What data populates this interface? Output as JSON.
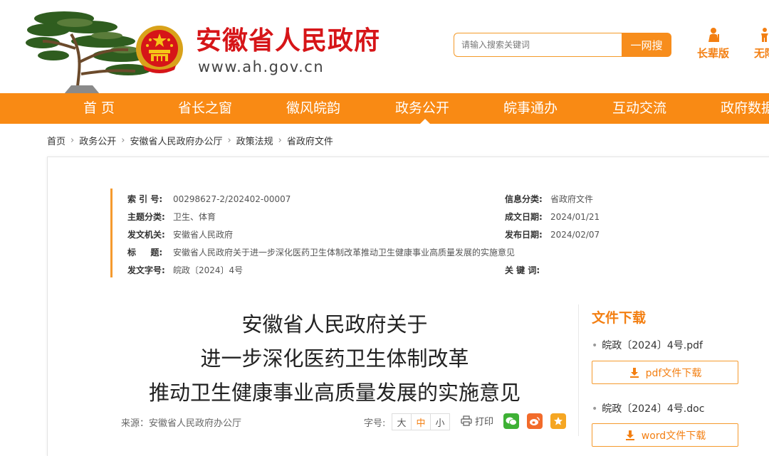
{
  "header": {
    "site_title": "安徽省人民政府",
    "site_url": "www.ah.gov.cn",
    "search_placeholder": "请输入搜索关键词",
    "search_button": "一网搜",
    "tools": [
      "长辈版",
      "无障"
    ]
  },
  "nav": {
    "items": [
      "首 页",
      "省长之窗",
      "徽风皖韵",
      "政务公开",
      "皖事通办",
      "互动交流",
      "政府数据"
    ],
    "active": "政务公开"
  },
  "breadcrumb": [
    "首页",
    "政务公开",
    "安徽省人民政府办公厅",
    "政策法规",
    "省政府文件"
  ],
  "info": {
    "index_label": "索 引 号:",
    "index_value": "00298627-2/202402-00007",
    "category_label": "信息分类:",
    "category_value": "省政府文件",
    "topic_label": "主题分类:",
    "topic_value": "卫生、体育",
    "created_label": "成文日期:",
    "created_value": "2024/01/21",
    "issuer_label": "发文机关:",
    "issuer_value": "安徽省人民政府",
    "published_label": "发布日期:",
    "published_value": "2024/02/07",
    "title_label": "标 　 题:",
    "title_value": "安徽省人民政府关于进一步深化医药卫生体制改革推动卫生健康事业高质量发展的实施意见",
    "docno_label": "发文字号:",
    "docno_value": "皖政〔2024〕4号",
    "keywords_label": "关 键 词:",
    "keywords_value": ""
  },
  "document": {
    "title_lines": [
      "安徽省人民政府关于",
      "进一步深化医药卫生体制改革",
      "推动卫生健康事业高质量发展的实施意见"
    ],
    "source": "来源：安徽省人民政府办公厅",
    "font_size_label": "字号:",
    "font_sizes": [
      "大",
      "中",
      "小"
    ],
    "font_size_active": "中",
    "print_label": "打印"
  },
  "sidebar": {
    "title": "文件下载",
    "files": [
      {
        "name": "皖政〔2024〕4号.pdf",
        "button": "pdf文件下载"
      },
      {
        "name": "皖政〔2024〕4号.doc",
        "button": "word文件下载"
      }
    ]
  },
  "colors": {
    "brand_red": "#d61518",
    "accent_orange": "#f98a14",
    "wechat_green": "#3eb135",
    "weibo_orange": "#f26b2b"
  }
}
